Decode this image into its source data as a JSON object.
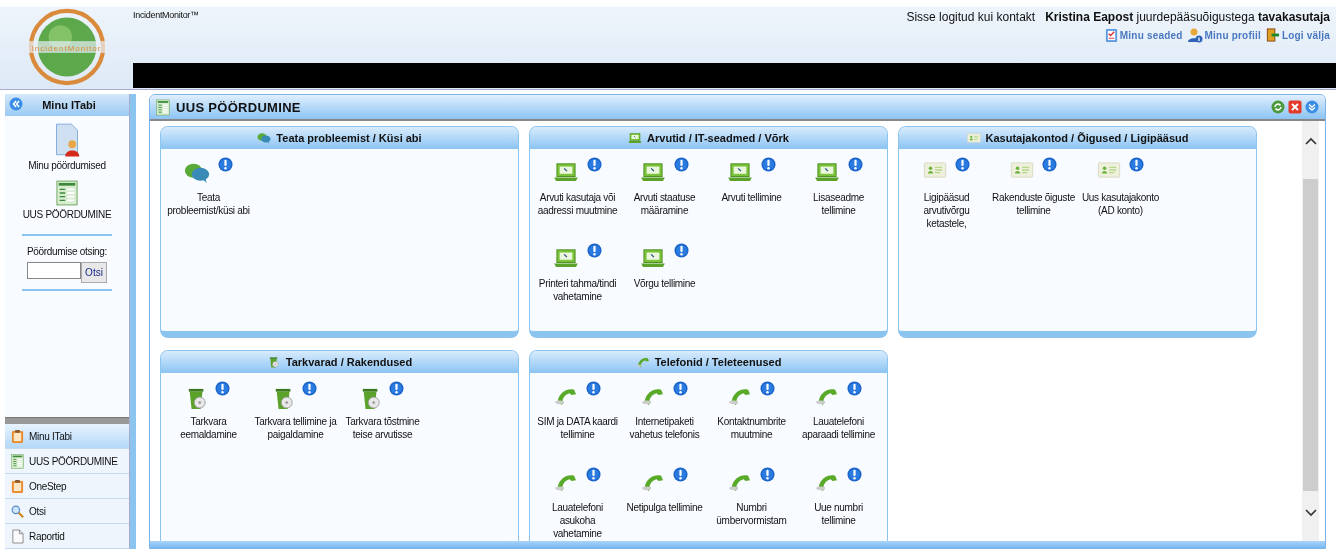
{
  "header": {
    "logo_text": "IncidentMonitor",
    "app_name": "IncidentMonitor™",
    "login_prefix": "Sisse logitud kui kontakt",
    "user_name": "Kristina Eapost",
    "rights_label": "juurdepääsuõigustega",
    "role": "tavakasutaja",
    "links": [
      {
        "kind": "settings",
        "label": "Minu seaded"
      },
      {
        "kind": "profile",
        "label": "Minu profiil"
      },
      {
        "kind": "logout",
        "label": "Logi välja"
      }
    ]
  },
  "sidebar": {
    "title": "Minu ITabi",
    "shortcuts": [
      {
        "kind": "requests",
        "label": "Minu pöördumised"
      },
      {
        "kind": "form",
        "label": "UUS PÖÖRDUMINE"
      }
    ],
    "search": {
      "label": "Pöördumise otsing:",
      "button": "Otsi"
    },
    "nav": [
      {
        "kind": "clipboard",
        "label": "Minu ITabi",
        "selected": true
      },
      {
        "kind": "form",
        "label": "UUS PÖÖRDUMINE",
        "selected": false
      },
      {
        "kind": "clipboard",
        "label": "OneStep",
        "selected": false
      },
      {
        "kind": "search",
        "label": "Otsi",
        "selected": false
      },
      {
        "kind": "document",
        "label": "Raportid",
        "selected": false
      }
    ]
  },
  "panel": {
    "title": "UUS PÖÖRDUMINE",
    "categories": [
      {
        "kind": "chat",
        "title": "Teata probleemist / Küsi abi",
        "items": [
          "Teata probleemist/küsi abi"
        ]
      },
      {
        "kind": "laptop",
        "title": "Arvutid / IT-seadmed / Võrk",
        "items": [
          "Arvuti kasutaja või aadressi muutmine",
          "Arvuti staatuse määramine",
          "Arvuti tellimine",
          "Lisaseadme tellimine",
          "Printeri tahma/tindi vahetamine",
          "Võrgu tellimine"
        ]
      },
      {
        "kind": "account",
        "title": "Kasutajakontod / Õigused / Ligipääsud",
        "items": [
          "Ligipääsud arvutivõrgu ketastele,",
          "Rakenduste õiguste tellimine",
          "Uus kasutajakonto (AD konto)"
        ]
      },
      {
        "kind": "software",
        "title": "Tarkvarad / Rakendused",
        "items": [
          "Tarkvara eemaldamine",
          "Tarkvara tellimine ja paigaldamine",
          "Tarkvara tõstmine teise arvutisse"
        ]
      },
      {
        "kind": "phone",
        "title": "Telefonid / Teleteenused",
        "items": [
          "SIM ja DATA kaardi tellimine",
          "Internetipaketi vahetus telefonis",
          "Kontaktnumbrite muutmine",
          "Lauatelefoni aparaadi tellimine",
          "Lauatelefoni asukoha vahetamine",
          "Netipulga tellimine",
          "Numbri ümbervormistam",
          "Uue numbri tellimine"
        ]
      }
    ]
  }
}
